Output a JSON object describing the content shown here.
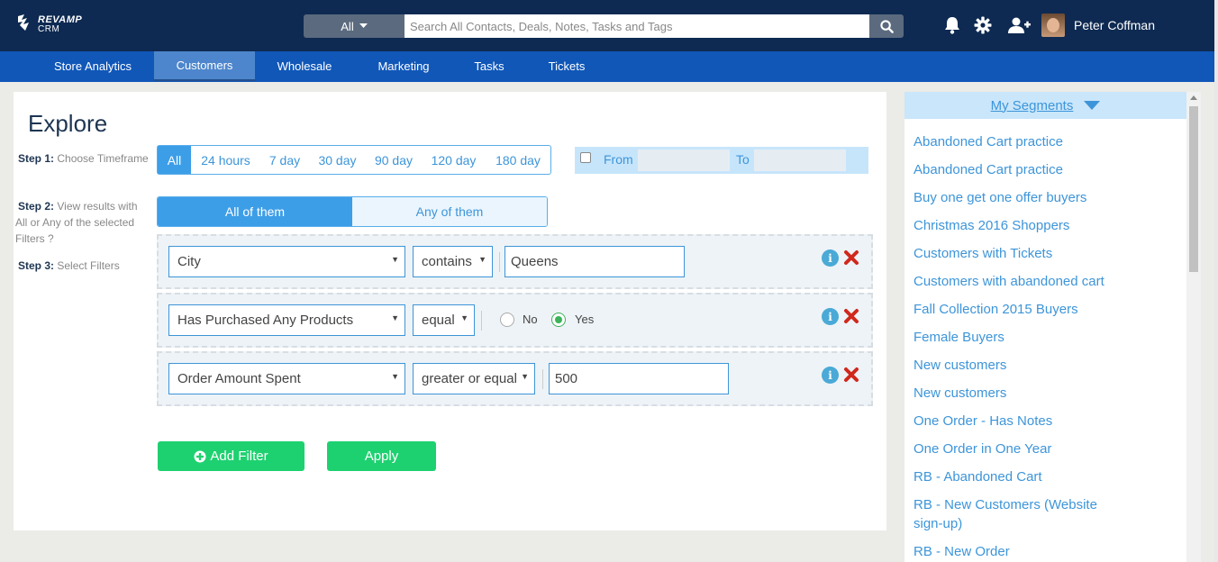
{
  "header": {
    "logo_line1": "REVAMP",
    "logo_line2": "CRM",
    "search_scope": "All",
    "search_placeholder": "Search All Contacts, Deals, Notes, Tasks and Tags",
    "user_name": "Peter Coffman",
    "icons": [
      "bell-icon",
      "gear-icon",
      "add-user-icon",
      "search-icon"
    ]
  },
  "nav": {
    "items": [
      {
        "label": "Store Analytics",
        "active": false
      },
      {
        "label": "Customers",
        "active": true
      },
      {
        "label": "Wholesale",
        "active": false
      },
      {
        "label": "Marketing",
        "active": false
      },
      {
        "label": "Tasks",
        "active": false
      },
      {
        "label": "Tickets",
        "active": false
      }
    ]
  },
  "explore": {
    "title": "Explore",
    "step1_label": "Step 1:",
    "step1_text": "Choose Timeframe",
    "step2_label": "Step 2:",
    "step2_text": "View results with All or Any of the selected Filters ?",
    "step3_label": "Step 3:",
    "step3_text": "Select Filters",
    "timeframes": [
      "All",
      "24 hours",
      "7 day",
      "30 day",
      "90 day",
      "120 day",
      "180 day"
    ],
    "active_timeframe": "All",
    "daterange": {
      "from_label": "From",
      "to_label": "To",
      "checked": false
    },
    "match_modes": [
      "All of them",
      "Any of them"
    ],
    "active_match_mode": "All of them",
    "filters": [
      {
        "field": "City",
        "operator": "contains",
        "value": "Queens"
      },
      {
        "field": "Has Purchased Any Products",
        "operator": "equal",
        "option_no": "No",
        "option_yes": "Yes",
        "selected": "Yes"
      },
      {
        "field": "Order Amount Spent",
        "operator": "greater or equal",
        "value": "500"
      }
    ],
    "add_filter_label": "Add Filter",
    "apply_label": "Apply"
  },
  "segments": {
    "header": "My Segments",
    "items": [
      "Abandoned Cart practice",
      "Abandoned Cart practice",
      "Buy one get one offer buyers",
      "Christmas 2016 Shoppers",
      "Customers with Tickets",
      "Customers with abandoned cart",
      "Fall Collection 2015 Buyers",
      "Female Buyers",
      "New customers",
      "New customers",
      "One Order - Has Notes",
      "One Order in One Year",
      "RB - Abandoned Cart",
      "RB - New Customers (Website sign-up)",
      "RB - New Order"
    ]
  },
  "colors": {
    "topbar": "#0e2a52",
    "navbar": "#1057b8",
    "accent": "#3d95d9",
    "green": "#1ed170",
    "delete": "#d0281c"
  }
}
